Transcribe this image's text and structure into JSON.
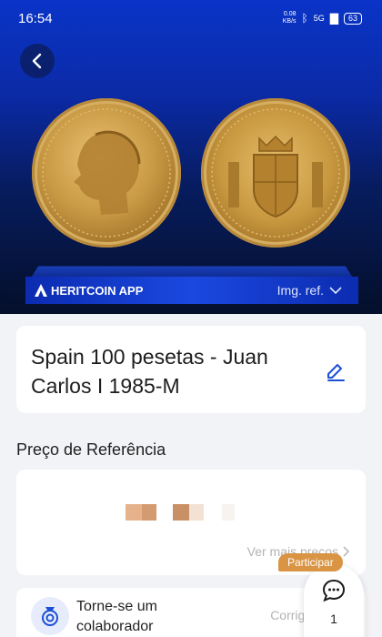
{
  "status_bar": {
    "time": "16:54",
    "net_speed_value": "0.08",
    "net_speed_unit": "KB/s",
    "network": "5G",
    "battery": "63"
  },
  "header": {
    "brand_name": "HERITCOIN APP",
    "image_reference_label": "Img. ref."
  },
  "coin": {
    "title": "Spain 100 pesetas - Juan Carlos I 1985-M"
  },
  "reference_price": {
    "section_title": "Preço de Referência",
    "more_prices_label": "Ver mais preços"
  },
  "collaborate": {
    "text": "Torne-se um colaborador",
    "correct_price_label": "Corrigir preço"
  },
  "chat": {
    "badge_label": "Participar",
    "count": "1"
  },
  "colors": {
    "accent_blue": "#1b4fd6",
    "participar_orange": "#d99444"
  }
}
